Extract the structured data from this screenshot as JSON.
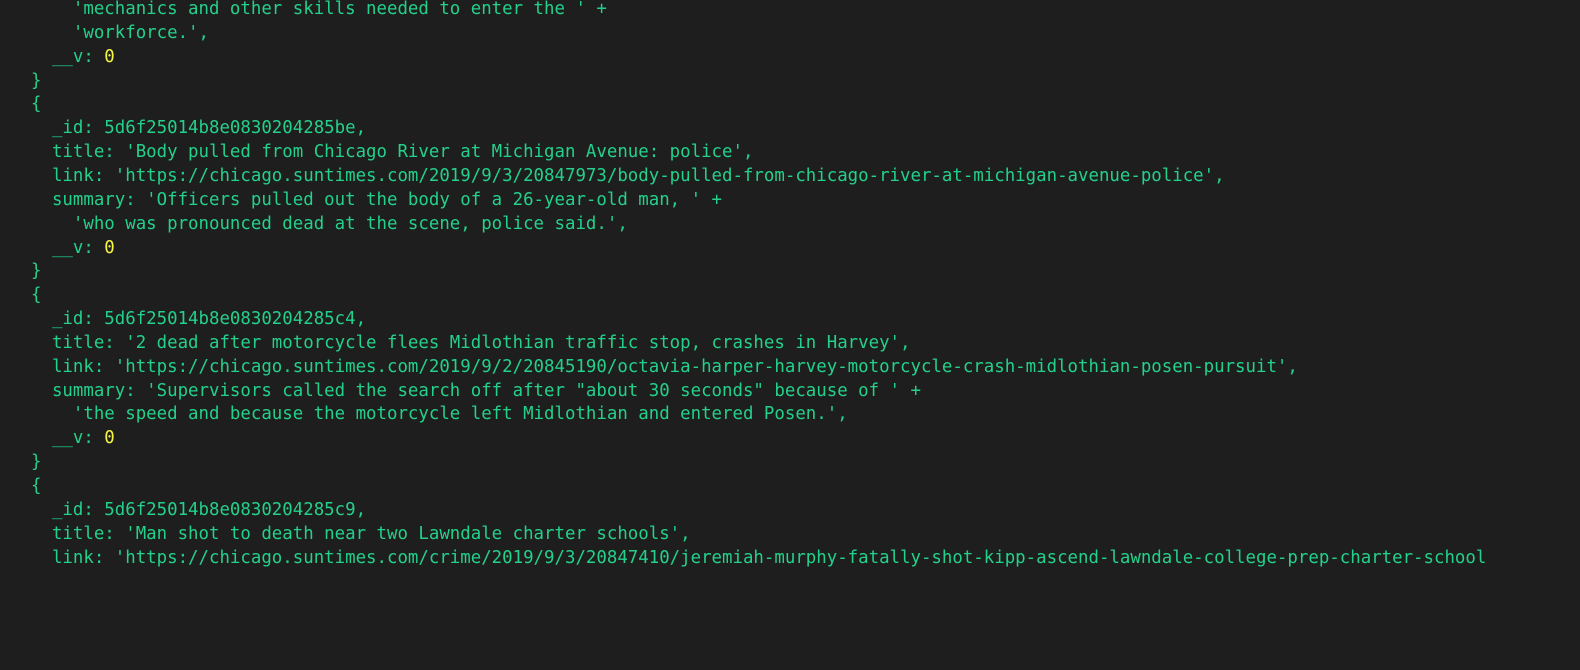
{
  "theme": {
    "background": "#1e1e1e",
    "text_color": "#23d18b",
    "number_color": "#f5f543"
  },
  "terminal": {
    "lines": [
      {
        "text": "    'mechanics and other skills needed to enter the ' +",
        "kind": "code"
      },
      {
        "text": "    'workforce.',",
        "kind": "code"
      },
      {
        "text": "  __v: ",
        "number": "0",
        "kind": "number-line"
      },
      {
        "text": "}",
        "kind": "code"
      },
      {
        "text": "{",
        "kind": "code"
      },
      {
        "text": "  _id: 5d6f25014b8e0830204285be,",
        "kind": "code"
      },
      {
        "text": "  title: 'Body pulled from Chicago River at Michigan Avenue: police',",
        "kind": "code"
      },
      {
        "text": "  link: 'https://chicago.suntimes.com/2019/9/3/20847973/body-pulled-from-chicago-river-at-michigan-avenue-police',",
        "kind": "code"
      },
      {
        "text": "  summary: 'Officers pulled out the body of a 26-year-old man, ' +",
        "kind": "code"
      },
      {
        "text": "    'who was pronounced dead at the scene, police said.',",
        "kind": "code"
      },
      {
        "text": "  __v: ",
        "number": "0",
        "kind": "number-line"
      },
      {
        "text": "}",
        "kind": "code"
      },
      {
        "text": "{",
        "kind": "code"
      },
      {
        "text": "  _id: 5d6f25014b8e0830204285c4,",
        "kind": "code"
      },
      {
        "text": "  title: '2 dead after motorcycle flees Midlothian traffic stop, crashes in Harvey',",
        "kind": "code"
      },
      {
        "text": "  link: 'https://chicago.suntimes.com/2019/9/2/20845190/octavia-harper-harvey-motorcycle-crash-midlothian-posen-pursuit',",
        "kind": "code"
      },
      {
        "text": "  summary: 'Supervisors called the search off after \"about 30 seconds\" because of ' +",
        "kind": "code"
      },
      {
        "text": "    'the speed and because the motorcycle left Midlothian and entered Posen.',",
        "kind": "code"
      },
      {
        "text": "  __v: ",
        "number": "0",
        "kind": "number-line"
      },
      {
        "text": "}",
        "kind": "code"
      },
      {
        "text": "{",
        "kind": "code"
      },
      {
        "text": "  _id: 5d6f25014b8e0830204285c9,",
        "kind": "code"
      },
      {
        "text": "  title: 'Man shot to death near two Lawndale charter schools',",
        "kind": "code"
      },
      {
        "text": "  link: 'https://chicago.suntimes.com/crime/2019/9/3/20847410/jeremiah-murphy-fatally-shot-kipp-ascend-lawndale-college-prep-charter-school",
        "kind": "code"
      }
    ]
  }
}
